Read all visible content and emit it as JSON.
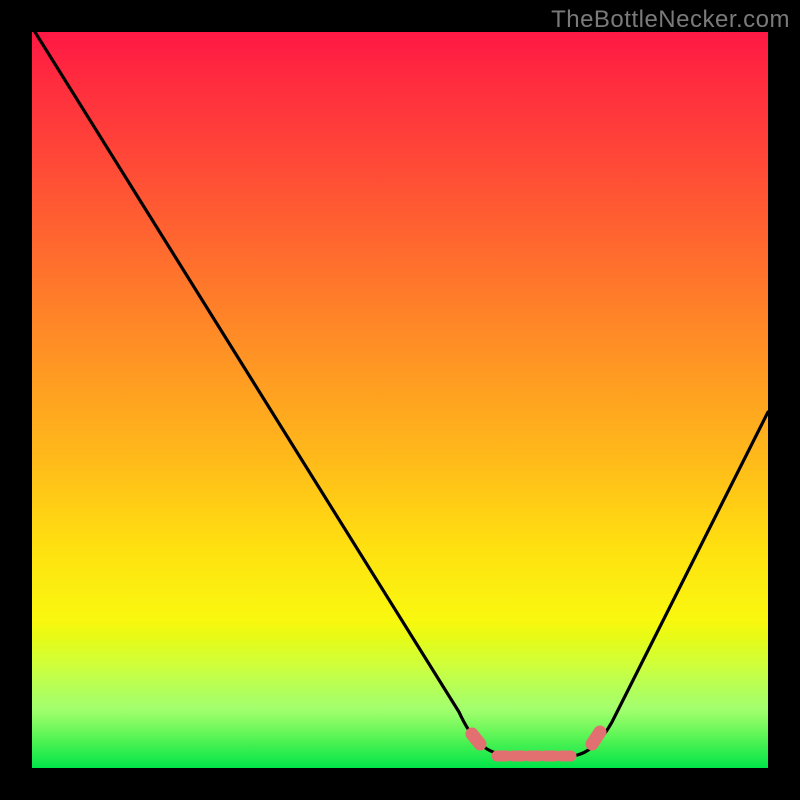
{
  "watermark": "TheBottleNecker.com",
  "chart_data": {
    "type": "line",
    "title": "",
    "xlabel": "",
    "ylabel": "",
    "xlim": [
      0,
      100
    ],
    "ylim": [
      0,
      100
    ],
    "x": [
      0,
      5,
      10,
      15,
      20,
      25,
      30,
      35,
      40,
      45,
      50,
      55,
      60,
      62,
      64,
      66,
      68,
      70,
      72,
      74,
      76,
      80,
      85,
      90,
      95,
      100
    ],
    "values": [
      100,
      91,
      82,
      74,
      66,
      58,
      50,
      42,
      34,
      26,
      18,
      12,
      6,
      3,
      1,
      0,
      0,
      0,
      0,
      1,
      3,
      8,
      16,
      26,
      37,
      48
    ],
    "annotations": {
      "flat_segment_x": [
        62,
        74
      ],
      "min_value": 0,
      "highlight_color": "#e27070"
    }
  }
}
